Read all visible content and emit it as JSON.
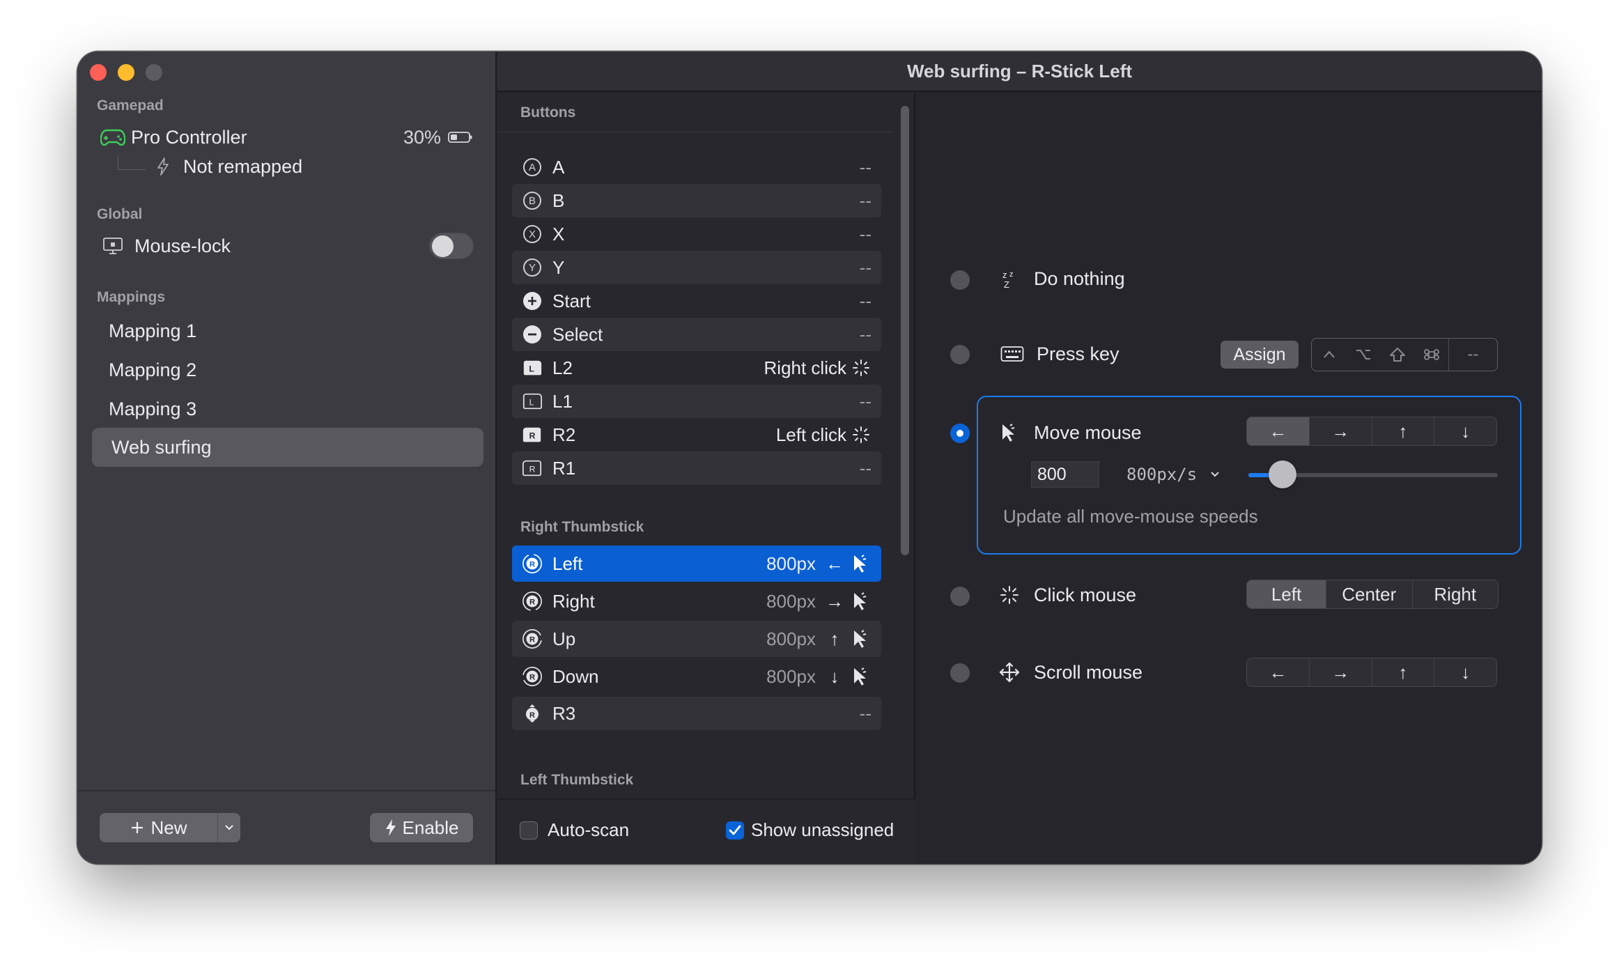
{
  "window": {
    "title": "Web surfing – R-Stick Left"
  },
  "sidebar": {
    "gamepad_label": "Gamepad",
    "controller_name": "Pro Controller",
    "battery": "30%",
    "remap_status": "Not remapped",
    "global_label": "Global",
    "mouse_lock_label": "Mouse-lock",
    "mouse_lock_on": false,
    "mappings_label": "Mappings",
    "mappings": [
      "Mapping 1",
      "Mapping 2",
      "Mapping 3",
      "Web surfing"
    ],
    "selected_mapping": "Web surfing",
    "new_label": "New",
    "enable_label": "Enable"
  },
  "middle": {
    "buttons_header": "Buttons",
    "buttons": [
      {
        "label": "A",
        "value": "--",
        "icon": "a-button-icon"
      },
      {
        "label": "B",
        "value": "--",
        "icon": "b-button-icon"
      },
      {
        "label": "X",
        "value": "--",
        "icon": "x-button-icon"
      },
      {
        "label": "Y",
        "value": "--",
        "icon": "y-button-icon"
      },
      {
        "label": "Start",
        "value": "--",
        "icon": "plus-icon"
      },
      {
        "label": "Select",
        "value": "--",
        "icon": "minus-icon"
      },
      {
        "label": "L2",
        "value": "Right click",
        "icon": "l-trigger-icon"
      },
      {
        "label": "L1",
        "value": "--",
        "icon": "l-bumper-icon"
      },
      {
        "label": "R2",
        "value": "Left click",
        "icon": "r-trigger-icon"
      },
      {
        "label": "R1",
        "value": "--",
        "icon": "r-bumper-icon"
      }
    ],
    "right_thumbstick_header": "Right Thumbstick",
    "right_thumbstick": [
      {
        "label": "Left",
        "value": "800px",
        "arrow": "←"
      },
      {
        "label": "Right",
        "value": "800px",
        "arrow": "→"
      },
      {
        "label": "Up",
        "value": "800px",
        "arrow": "↑"
      },
      {
        "label": "Down",
        "value": "800px",
        "arrow": "↓"
      },
      {
        "label": "R3",
        "value": "--"
      }
    ],
    "left_thumbstick_header": "Left Thumbstick",
    "auto_scan_label": "Auto-scan",
    "auto_scan_checked": false,
    "show_unassigned_label": "Show unassigned",
    "show_unassigned_checked": true
  },
  "right": {
    "do_nothing_label": "Do nothing",
    "press_key_label": "Press key",
    "assign_label": "Assign",
    "modifier_keys": [
      "^",
      "⌥",
      "⇧",
      "⌘"
    ],
    "key_placeholder": "--",
    "move_mouse_label": "Move mouse",
    "move_directions": [
      "←",
      "→",
      "↑",
      "↓"
    ],
    "move_selected_direction": "←",
    "speed_value": "800",
    "speed_select": "800px/s",
    "speed_slider_fraction": 0.11,
    "update_all_label": "Update all move-mouse speeds",
    "click_mouse_label": "Click mouse",
    "click_options": [
      "Left",
      "Center",
      "Right"
    ],
    "click_selected": "Left",
    "scroll_mouse_label": "Scroll mouse",
    "scroll_directions": [
      "←",
      "→",
      "↑",
      "↓"
    ],
    "selected_option": "Move mouse",
    "accent_color": "#1b7cf0"
  }
}
